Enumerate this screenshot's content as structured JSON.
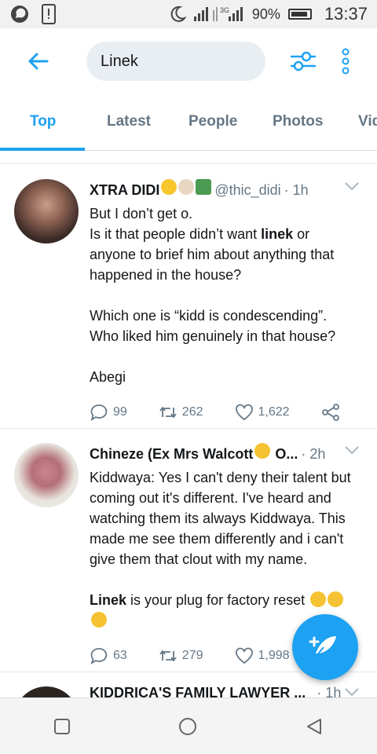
{
  "status_bar": {
    "network_label": "3G",
    "battery": "90%",
    "time": "13:37"
  },
  "header": {
    "search_value": "Linek"
  },
  "tabs": [
    {
      "label": "Top",
      "active": true
    },
    {
      "label": "Latest",
      "active": false
    },
    {
      "label": "People",
      "active": false
    },
    {
      "label": "Photos",
      "active": false
    },
    {
      "label": "Vid",
      "active": false
    }
  ],
  "tweets": [
    {
      "name": "XTRA DIDI",
      "handle": "@thic_didi",
      "time": "· 1h",
      "text_before": "But I don’t get o.\nIs it that people didn’t want ",
      "highlight": "linek",
      "text_after": " or anyone to brief him about anything that happened in the house?\n\nWhich one is “kidd is condescending”. Who liked him genuinely in that house?\n\nAbegi",
      "replies": "99",
      "retweets": "262",
      "likes": "1,622"
    },
    {
      "name": "Chineze (Ex Mrs Walcott",
      "name_suffix": "O...",
      "time": "· 2h",
      "text_before": "Kiddwaya: Yes I can't deny their talent but coming out it's different. I've heard and watching them its always Kiddwaya. This made me see them differently and i can't give them that clout with my name.\n\n",
      "highlight": "Linek",
      "text_after": " is your plug for factory reset",
      "replies": "63",
      "retweets": "279",
      "likes": "1,998"
    },
    {
      "name": "KIDDRICA'S FAMILY LAWYER ...",
      "time": "· 1h"
    }
  ],
  "colors": {
    "accent": "#1da1f2",
    "secondary_text": "#657786",
    "primary_text": "#14171a"
  },
  "icons": [
    "whatsapp-icon",
    "phone-alert-icon",
    "moon-icon",
    "signal-icon",
    "battery-icon",
    "back-arrow-icon",
    "filter-icon",
    "more-icon",
    "reply-icon",
    "retweet-icon",
    "like-icon",
    "share-icon",
    "compose-icon",
    "recents-icon",
    "home-icon",
    "back-nav-icon"
  ]
}
